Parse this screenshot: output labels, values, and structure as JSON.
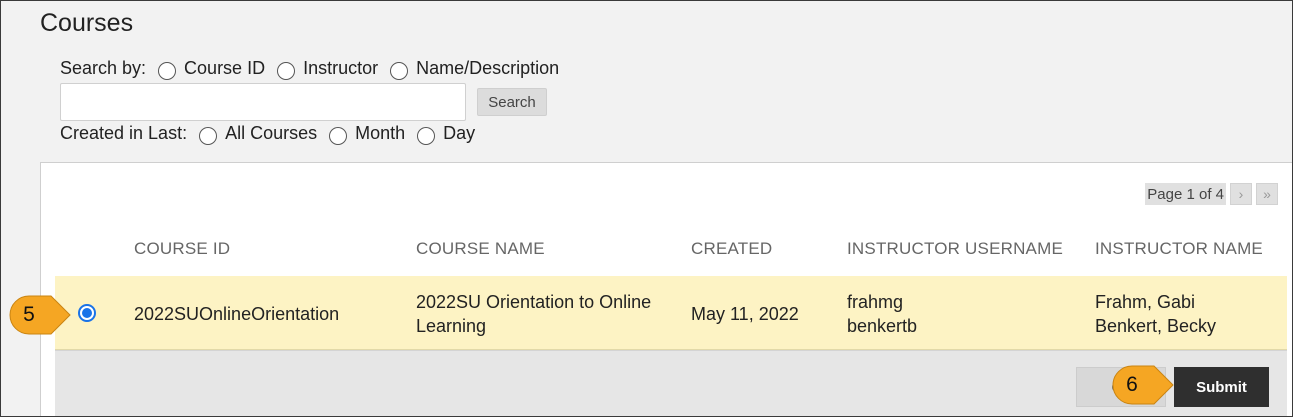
{
  "page": {
    "title": "Courses"
  },
  "search": {
    "search_by_label": "Search by:",
    "options": [
      "Course ID",
      "Instructor",
      "Name/Description"
    ],
    "input_value": "",
    "button_label": "Search"
  },
  "created": {
    "label": "Created in Last:",
    "options": [
      "All Courses",
      "Month",
      "Day"
    ]
  },
  "pager": {
    "label": "Page 1 of 4",
    "next_icon": "chevron-right-icon",
    "last_icon": "double-chevron-right-icon"
  },
  "table": {
    "columns": [
      "COURSE ID",
      "COURSE NAME",
      "CREATED",
      "INSTRUCTOR USERNAME",
      "INSTRUCTOR NAME"
    ],
    "rows": [
      {
        "course_id": "2022SUOnlineOrientation",
        "course_name_line1": "2022SU Orientation to Online",
        "course_name_line2": "Learning",
        "created": "May 11, 2022",
        "username1": "frahmg",
        "username2": "benkertb",
        "name1": "Frahm, Gabi",
        "name2": "Benkert, Becky",
        "selected": true
      }
    ]
  },
  "footer": {
    "cancel_label": "Ca",
    "submit_label": "Submit"
  },
  "callouts": [
    {
      "number": "5",
      "color": "#f5a623"
    },
    {
      "number": "6",
      "color": "#f5a623"
    }
  ],
  "colors": {
    "row_highlight": "#fdf3c4",
    "accent": "#1a73e8",
    "submit_bg": "#2f2f2f"
  }
}
